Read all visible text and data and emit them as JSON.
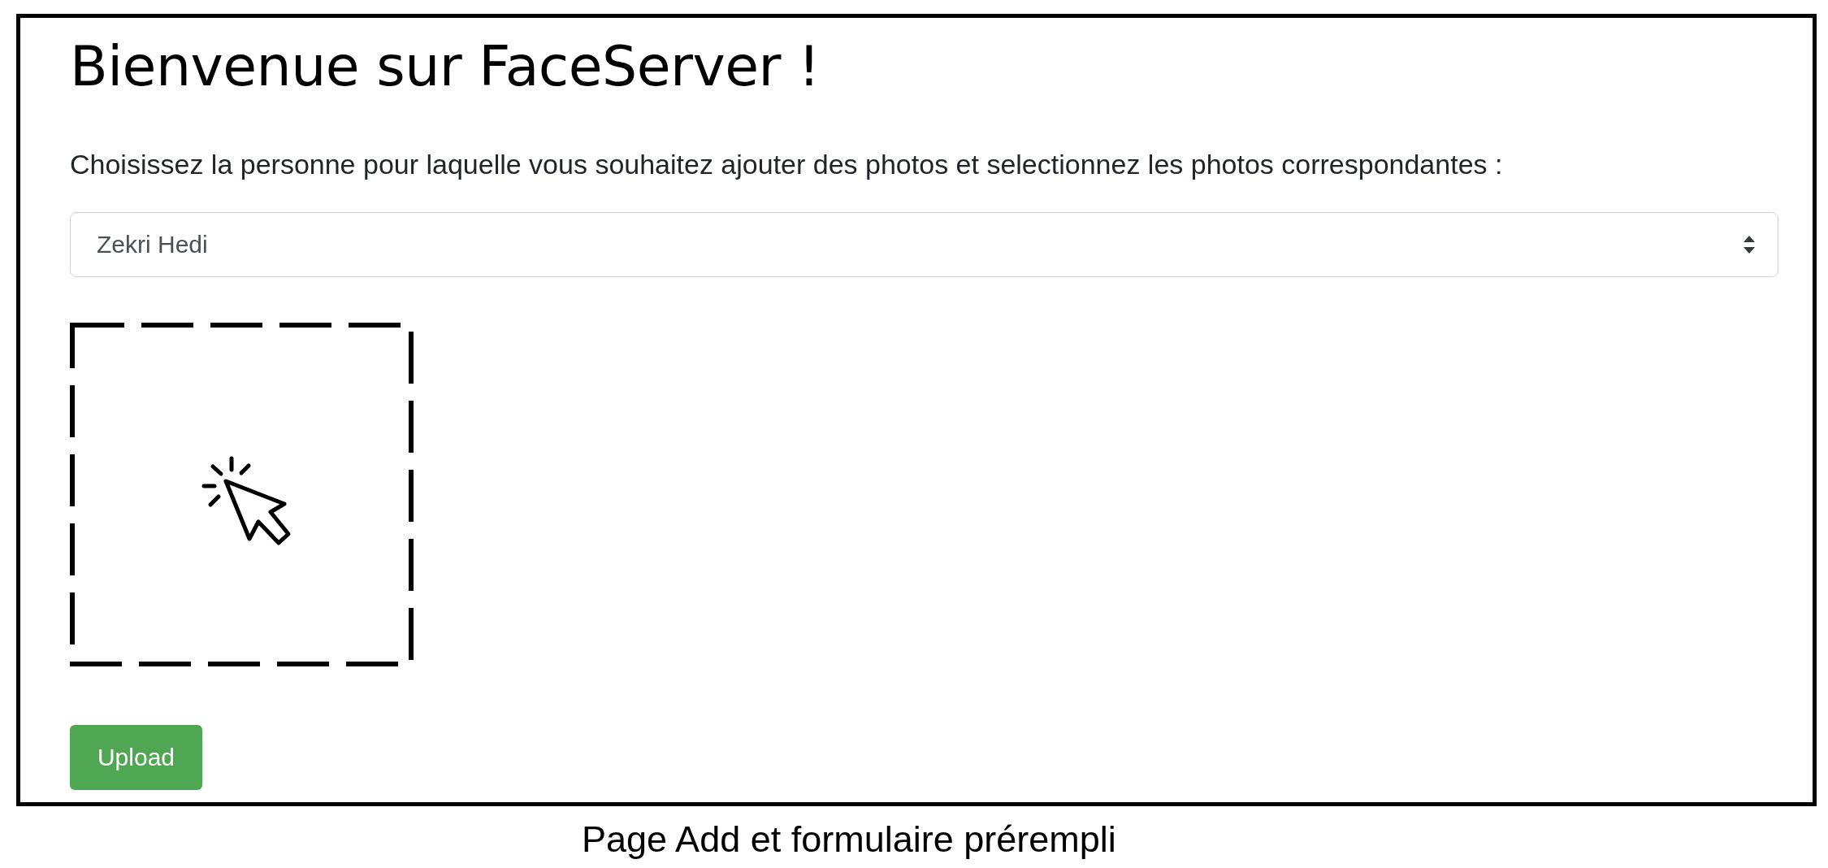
{
  "page": {
    "title": "Bienvenue sur FaceServer !",
    "instruction": "Choisissez la personne pour laquelle vous souhaitez ajouter des photos et selectionnez les photos correspondantes :",
    "person_select": {
      "value": "Zekri Hedi"
    },
    "upload_button": {
      "label": "Upload"
    }
  },
  "caption": "Page Add et formulaire prérempli"
}
